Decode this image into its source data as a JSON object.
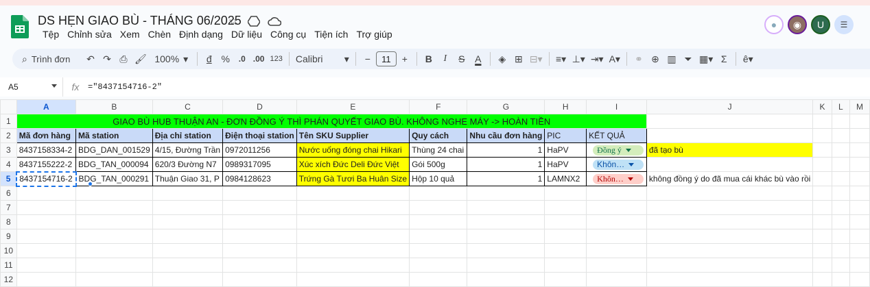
{
  "doc": {
    "title": "DS HẸN GIAO BÙ - THÁNG 06/2025"
  },
  "menu": [
    "Tệp",
    "Chỉnh sửa",
    "Xem",
    "Chèn",
    "Định dạng",
    "Dữ liệu",
    "Công cụ",
    "Tiện ích",
    "Trợ giúp"
  ],
  "avatars": [
    {
      "label": "",
      "color": "#ffffff"
    },
    {
      "label": "",
      "color": "#8d6e63"
    },
    {
      "label": "U",
      "color": "#2e6b4f"
    },
    {
      "label": "",
      "color": "#5f6368"
    }
  ],
  "toolbar": {
    "search": "Trình đơn",
    "zoom": "100%",
    "currency": "đ",
    "percent": "%",
    "dec_less": ".0",
    "dec_more": ".00",
    "format_num": "123",
    "font": "Calibri",
    "font_size": "11",
    "bold": "B",
    "italic": "I",
    "strike": "S",
    "text_color": "A",
    "sum": "Σ"
  },
  "formula_bar": {
    "cell_ref": "A5",
    "fx": "fx",
    "formula": "=\"8437154716-2\""
  },
  "columns": [
    "A",
    "B",
    "C",
    "D",
    "E",
    "F",
    "G",
    "H",
    "I",
    "J",
    "K",
    "L",
    "M"
  ],
  "rows": [
    "1",
    "2",
    "3",
    "4",
    "5",
    "6",
    "7",
    "8",
    "9",
    "10",
    "11",
    "12"
  ],
  "banner": "GIAO BÙ HUB THUẬN AN - ĐƠN ĐỒNG Ý THÌ PHÁN QUYẾT GIAO BÙ.  KHÔNG NGHE MÁY -> HOÀN TIỀN",
  "headers": [
    "Mã đơn hàng",
    "Mã station",
    "Địa chỉ station",
    "Điện thoại station",
    "Tên SKU Supplier",
    "Quy cách",
    "Nhu cầu đơn hàng",
    "PIC",
    "KẾT QUẢ"
  ],
  "data_rows": [
    {
      "order": "8437158334-2",
      "station": "BDG_DAN_001529",
      "address": "4/15, Đường Trần",
      "phone": "0972011256",
      "sku": "Nước uống đóng chai Hikari",
      "spec": "Thùng 24 chai",
      "qty": "1",
      "pic": "HaPV",
      "result": "Đồng ý",
      "note": "đã tạo bù"
    },
    {
      "order": "8437155222-2",
      "station": "BDG_TAN_000094",
      "address": "620/3 Đường N7",
      "phone": "0989317095",
      "sku": "Xúc xích Đức Deli Đức Việt",
      "spec": "Gói 500g",
      "qty": "1",
      "pic": "HaPV",
      "result": "Khôn…",
      "note": ""
    },
    {
      "order": "8437154716-2",
      "station": "BDG_TAN_000291",
      "address": "Thuận Giao 31, P",
      "phone": "0984128623",
      "sku": "Trứng Gà Tươi Ba Huân Size",
      "spec": "Hộp 10 quả",
      "qty": "1",
      "pic": "LAMNX2",
      "result": "Khôn…",
      "note": "không đồng ý do đã mua cái khác bù vào rồi"
    }
  ],
  "colors": {
    "banner": "#00ff00",
    "header": "#c9daf8",
    "highlight": "#ffff00",
    "accent": "#1a73e8"
  }
}
